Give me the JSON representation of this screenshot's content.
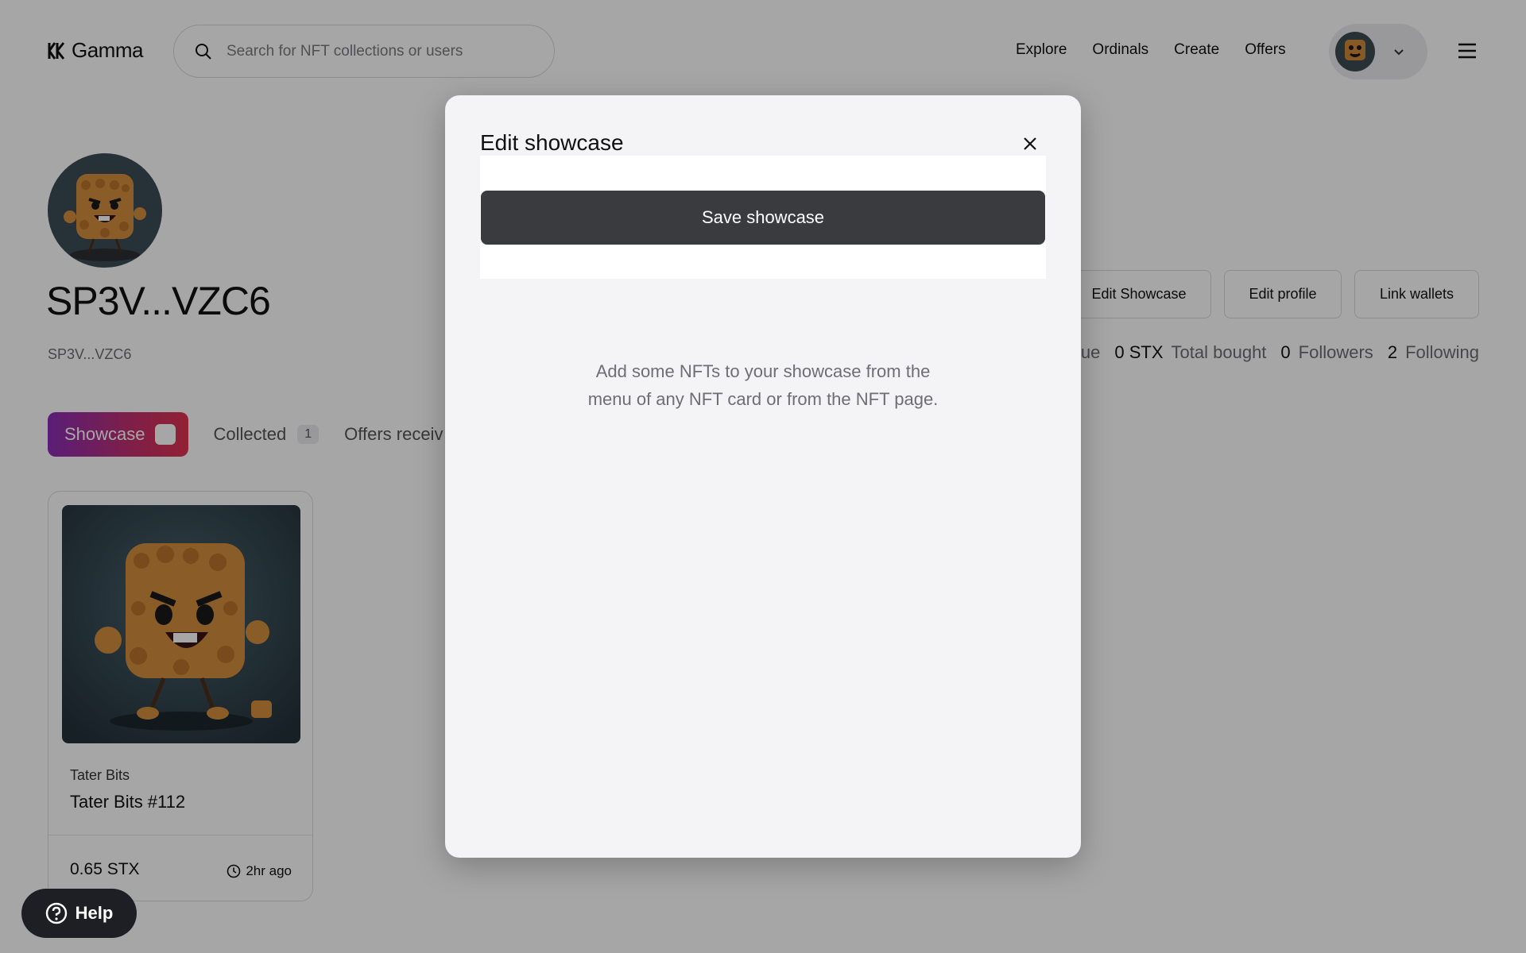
{
  "header": {
    "logo_text": "Gamma",
    "search_placeholder": "Search for NFT collections or users",
    "nav": [
      "Explore",
      "Ordinals",
      "Create",
      "Offers"
    ]
  },
  "profile": {
    "name": "SP3V...VZC6",
    "address": "SP3V...VZC6",
    "actions": {
      "edit_showcase": "Edit Showcase",
      "edit_profile": "Edit profile",
      "link_wallets": "Link wallets"
    },
    "stats": [
      {
        "value": "",
        "label": "ue"
      },
      {
        "value": "0 STX",
        "label": "Total bought"
      },
      {
        "value": "0",
        "label": "Followers"
      },
      {
        "value": "2",
        "label": "Following"
      }
    ]
  },
  "tabs": {
    "showcase": "Showcase",
    "collected": "Collected",
    "collected_count": "1",
    "offers": "Offers receiv"
  },
  "nft_card": {
    "collection": "Tater Bits",
    "title": "Tater Bits #112",
    "price": "0.65 STX",
    "time": "2hr ago"
  },
  "help": {
    "label": "Help"
  },
  "modal": {
    "title": "Edit showcase",
    "save_label": "Save showcase",
    "empty_text": "Add some NFTs to your showcase from the menu of any NFT card or from the NFT page."
  },
  "colors": {
    "overlay": "#000000",
    "save_button": "#3a3b3f",
    "tab_gradient_start": "#8a2fb8",
    "tab_gradient_end": "#e0334f",
    "help_button": "#1d1f24"
  }
}
